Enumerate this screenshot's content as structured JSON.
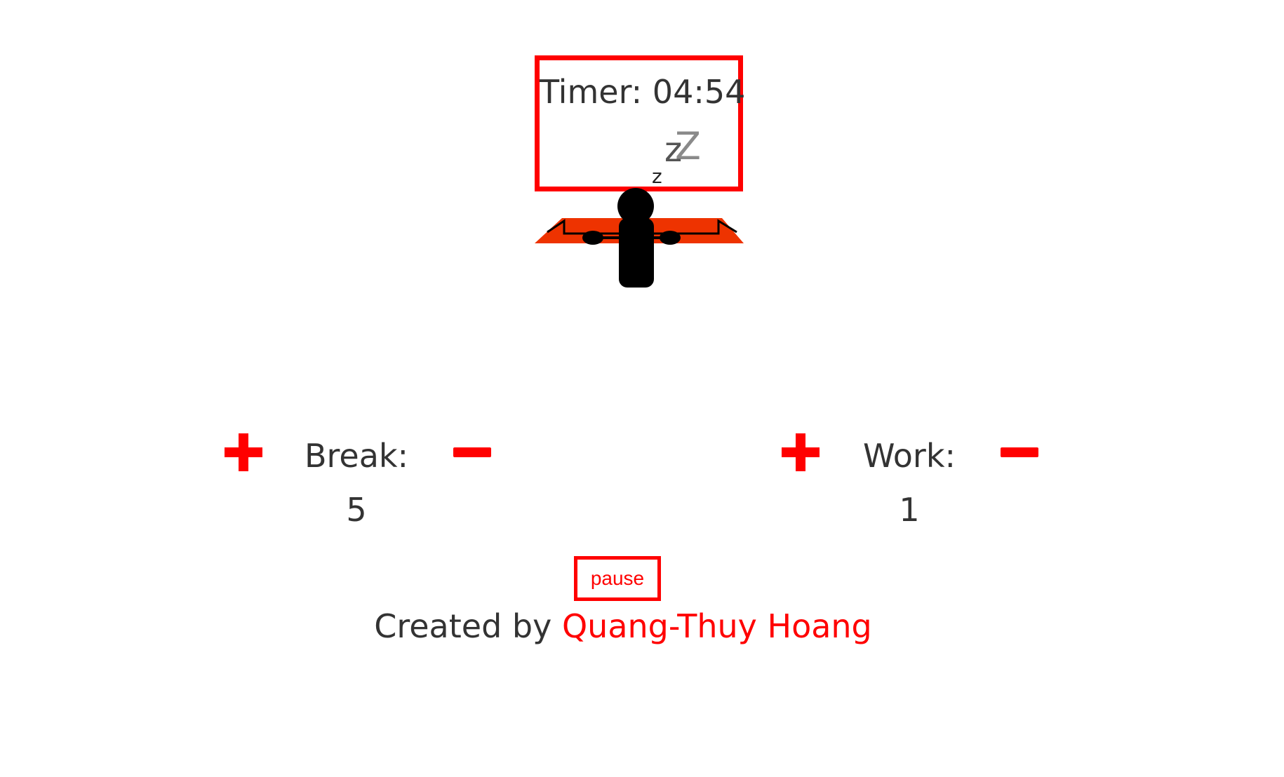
{
  "timer": {
    "label": "Timer: 04:54"
  },
  "sleep": {
    "z_big_back": "Z",
    "z_big_front": "z",
    "z_small": "z"
  },
  "break": {
    "label": "Break:",
    "value": "5",
    "increment_icon": "plus-icon",
    "decrement_icon": "minus-icon"
  },
  "work": {
    "label": "Work:",
    "value": "1",
    "increment_icon": "plus-icon",
    "decrement_icon": "minus-icon"
  },
  "controls": {
    "pause_label": "pause"
  },
  "credits": {
    "prefix": "Created by ",
    "author": "Quang-Thuy Hoang"
  },
  "colors": {
    "accent": "#ff0000",
    "text": "#333333",
    "desk": "#ee3300",
    "figure": "#000000"
  }
}
